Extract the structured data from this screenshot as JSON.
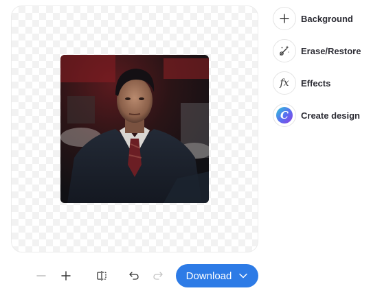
{
  "tools": [
    {
      "label": "Background",
      "icon": "plus-icon"
    },
    {
      "label": "Erase/Restore",
      "icon": "magic-wand-icon"
    },
    {
      "label": "Effects",
      "icon": "fx-icon"
    },
    {
      "label": "Create design",
      "icon": "canva-logo-icon"
    }
  ],
  "effects_icon_text": "fx",
  "canva_logo_letter": "C",
  "toolbar": {
    "zoom_out": "zoom-out-icon",
    "zoom_in": "zoom-in-icon",
    "compare": "compare-icon",
    "undo": "undo-icon",
    "redo": "redo-icon",
    "download_label": "Download"
  },
  "colors": {
    "accent": "#2d7be6",
    "text": "#2b2b33"
  }
}
